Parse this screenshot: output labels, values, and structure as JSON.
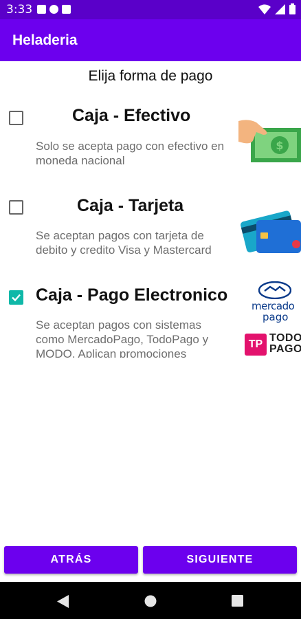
{
  "status_bar": {
    "time": "3:33"
  },
  "app_bar": {
    "title": "Heladeria"
  },
  "heading": "Elija forma de pago",
  "options": [
    {
      "title": "Caja - Efectivo",
      "description": "Solo se acepta pago con efectivo en moneda nacional",
      "checked": false,
      "icon": "cash-icon"
    },
    {
      "title": "Caja - Tarjeta",
      "description": "Se aceptan pagos con tarjeta de debito y credito Visa y Mastercard",
      "checked": false,
      "icon": "credit-card-icon"
    },
    {
      "title": "Caja - Pago Electronico",
      "description": "Se aceptan pagos con sistemas como MercadoPago, TodoPago y MODO. Aplican promociones",
      "checked": true,
      "icon": "mercadopago-todopago-logos"
    }
  ],
  "logos": {
    "mercado_line1": "mercado",
    "mercado_line2": "pago",
    "todo_line1": "TODO",
    "todo_line2": "PAGO",
    "todo_mark": "TP"
  },
  "buttons": {
    "back": "ATRÁS",
    "next": "SIGUIENTE"
  },
  "colors": {
    "status_bar": "#5a00c9",
    "primary": "#6c00ee",
    "checkbox_checked": "#0fb8a8"
  }
}
